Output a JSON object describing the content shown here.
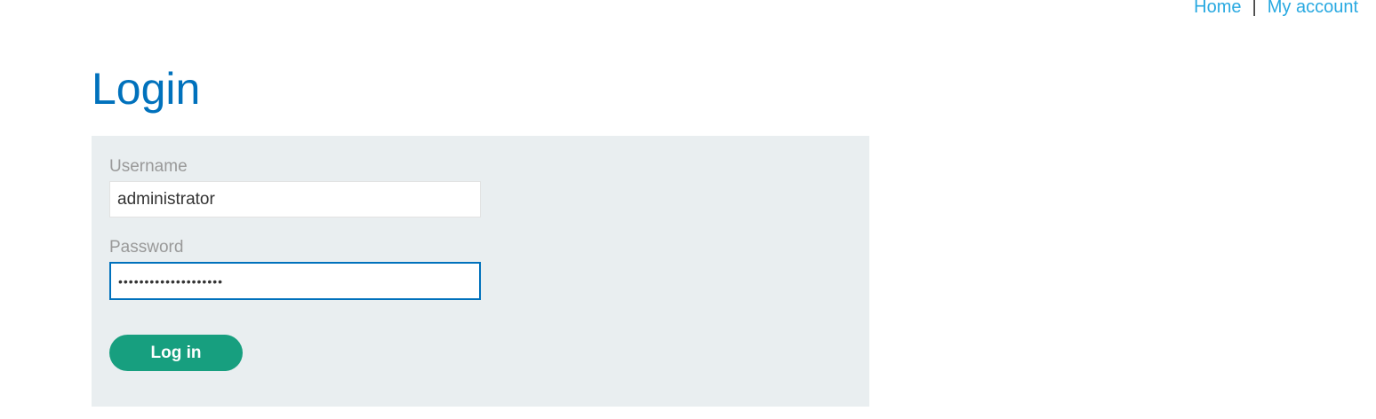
{
  "header": {
    "nav": {
      "home_label": "Home",
      "separator": "|",
      "account_label": "My account"
    }
  },
  "main": {
    "title": "Login",
    "form": {
      "username_label": "Username",
      "username_value": "administrator",
      "password_label": "Password",
      "password_value": "••••••••••••••••••••",
      "submit_label": "Log in"
    }
  },
  "colors": {
    "title": "#0071bc",
    "link": "#29a9e1",
    "panel_background": "#e9eef0",
    "button": "#179f7f",
    "focus_border": "#0071bc"
  }
}
